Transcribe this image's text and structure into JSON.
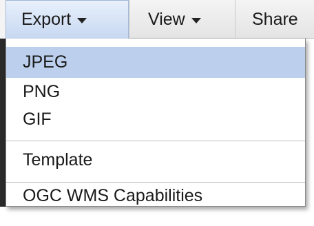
{
  "toolbar": {
    "export_label": "Export",
    "view_label": "View",
    "share_label": "Share"
  },
  "export_menu": {
    "items": [
      {
        "label": "JPEG",
        "selected": true
      },
      {
        "label": "PNG",
        "selected": false
      },
      {
        "label": "GIF",
        "selected": false
      },
      {
        "label": "Template",
        "selected": false
      },
      {
        "label": "OGC WMS Capabilities",
        "selected": false
      }
    ]
  },
  "colors": {
    "highlight": "#bcd0ee",
    "active_button_top": "#e8f0fb",
    "active_button_bottom": "#c7d8f2"
  }
}
